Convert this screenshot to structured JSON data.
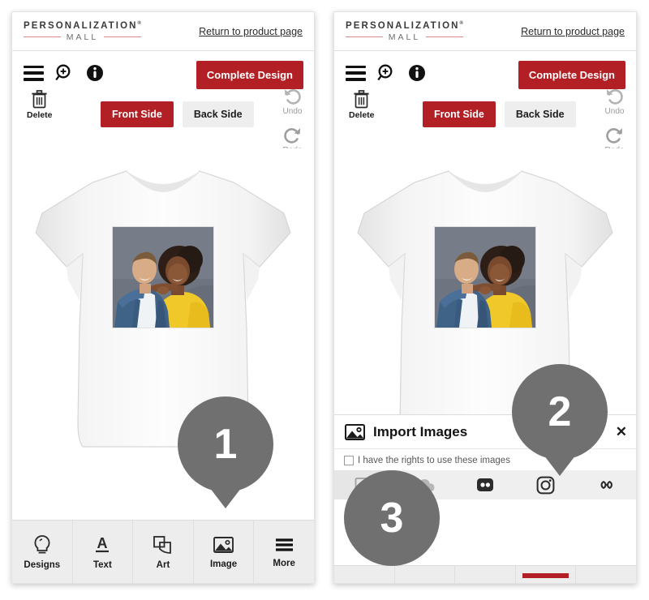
{
  "brand": {
    "name_top": "PERSONALIZATION",
    "registered": "®",
    "name_bottom": "MALL",
    "return_link": "Return to product page"
  },
  "toolbar": {
    "menu_icon": "hamburger-menu-icon",
    "zoom_icon": "zoom-in-icon",
    "info_icon": "info-icon",
    "complete_label": "Complete Design",
    "delete_label": "Delete",
    "undo_label": "Undo",
    "redo_label": "Redo"
  },
  "side_tabs": [
    {
      "label": "Front Side",
      "active": true
    },
    {
      "label": "Back Side",
      "active": false
    }
  ],
  "canvas": {
    "product": "white-t-shirt",
    "print_description": "photo of a smiling couple, man in denim jacket and woman in yellow top against a gray backdrop"
  },
  "bottom_nav": [
    {
      "label": "Designs",
      "icon": "lightbulb-icon",
      "active": false
    },
    {
      "label": "Text",
      "icon": "text-a-icon",
      "active": false
    },
    {
      "label": "Art",
      "icon": "shapes-icon",
      "active": false
    },
    {
      "label": "Image",
      "icon": "picture-icon",
      "active": true
    },
    {
      "label": "More",
      "icon": "more-lines-icon",
      "active": false
    }
  ],
  "import_drawer": {
    "icon": "picture-icon",
    "title": "Import Images",
    "close_icon": "close-icon",
    "rights_label": "I have the rights to use these images",
    "rights_checked": false,
    "sources": [
      {
        "icon": "gallery-icon",
        "name": "device-gallery"
      },
      {
        "icon": "cloud-upload-icon",
        "name": "cloud-upload"
      },
      {
        "icon": "flickr-icon",
        "name": "flickr"
      },
      {
        "icon": "instagram-icon",
        "name": "instagram"
      },
      {
        "icon": "link-icon",
        "name": "image-url"
      }
    ]
  },
  "markers": [
    {
      "label": "1",
      "shape": "pin"
    },
    {
      "label": "2",
      "shape": "pin"
    },
    {
      "label": "3",
      "shape": "plain"
    }
  ],
  "colors": {
    "brand_red": "#b22025",
    "marker_gray": "#707070",
    "rule_pink": "#d98b8b"
  }
}
